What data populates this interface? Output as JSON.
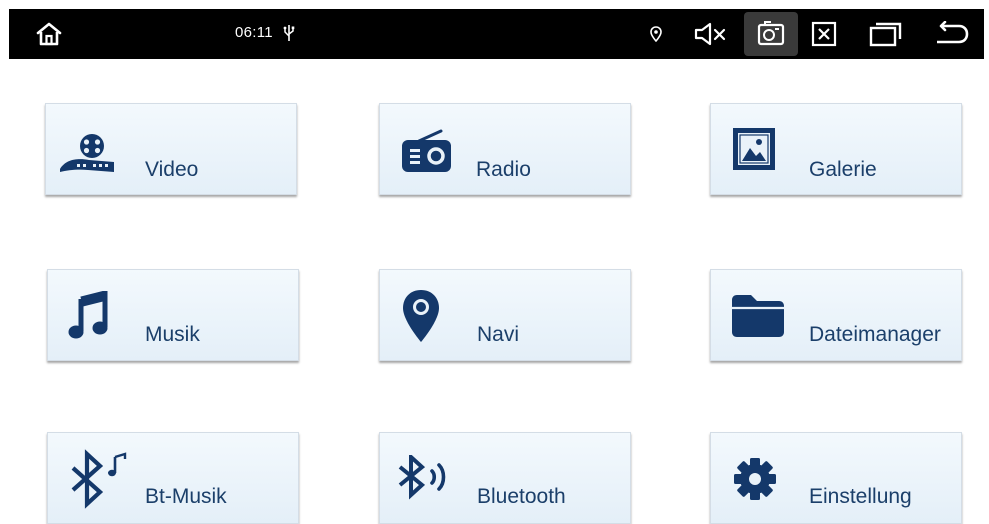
{
  "status_bar": {
    "time": "06:11",
    "icons": [
      "home-icon",
      "usb-icon",
      "location-icon",
      "volume-mute-icon",
      "screenshot-icon",
      "close-app-icon",
      "recent-apps-icon",
      "back-icon"
    ]
  },
  "colors": {
    "tile_text": "#1b3f6a",
    "icon": "#14386a",
    "status_bar": "#000000"
  },
  "tiles": [
    {
      "label": "Video",
      "icon": "film-reel-icon"
    },
    {
      "label": "Radio",
      "icon": "radio-icon"
    },
    {
      "label": "Galerie",
      "icon": "gallery-icon"
    },
    {
      "label": "Musik",
      "icon": "music-note-icon"
    },
    {
      "label": "Navi",
      "icon": "map-pin-icon"
    },
    {
      "label": "Dateimanager",
      "icon": "folder-icon"
    },
    {
      "label": "Bt-Musik",
      "icon": "bluetooth-music-icon"
    },
    {
      "label": "Bluetooth",
      "icon": "bluetooth-audio-icon"
    },
    {
      "label": "Einstellung",
      "icon": "gear-icon"
    }
  ]
}
